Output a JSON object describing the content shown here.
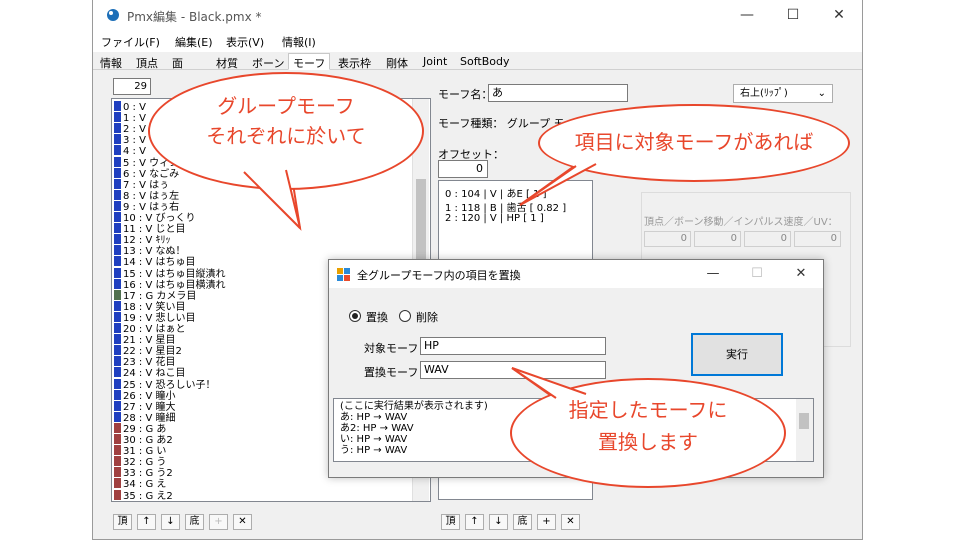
{
  "window": {
    "title": "Pmx編集 - Black.pmx *",
    "minimize": "—",
    "maximize": "☐",
    "close": "✕"
  },
  "menu": [
    "ファイル(F)",
    "編集(E)",
    "表示(V)",
    "情報(I)"
  ],
  "tabs": [
    "情報",
    "頂点",
    "面",
    "材質",
    "ボーン",
    "モーフ",
    "表示枠",
    "剛体",
    "Joint",
    "SoftBody"
  ],
  "left": {
    "count": "29",
    "rows": [
      {
        "text": "0 : V",
        "color": "#2040c0"
      },
      {
        "text": "1 : V",
        "color": "#2040c0"
      },
      {
        "text": "2 : V",
        "color": "#2040c0"
      },
      {
        "text": "3 : V",
        "color": "#2040c0"
      },
      {
        "text": "4 : V",
        "color": "#2040c0"
      },
      {
        "text": "5 : V  ウィンク",
        "color": "#2040c0"
      },
      {
        "text": "6 : V  なごみ",
        "color": "#2040c0"
      },
      {
        "text": "7 : V  はぅ",
        "color": "#2040c0"
      },
      {
        "text": "8 : V  はぅ左",
        "color": "#2040c0"
      },
      {
        "text": "9 : V  はぅ右",
        "color": "#2040c0"
      },
      {
        "text": "10 : V  びっくり",
        "color": "#2040c0"
      },
      {
        "text": "11 : V  じと目",
        "color": "#2040c0"
      },
      {
        "text": "12 : V  ｷﾘｯ",
        "color": "#2040c0"
      },
      {
        "text": "13 : V  なぬ！",
        "color": "#2040c0"
      },
      {
        "text": "14 : V  はちゅ目",
        "color": "#2040c0"
      },
      {
        "text": "15 : V  はちゅ目縦潰れ",
        "color": "#2040c0"
      },
      {
        "text": "16 : V  はちゅ目横潰れ",
        "color": "#2040c0"
      },
      {
        "text": "17 : G  カメラ目",
        "color": "#507050"
      },
      {
        "text": "18 : V  笑い目",
        "color": "#2040c0"
      },
      {
        "text": "19 : V  悲しい目",
        "color": "#2040c0"
      },
      {
        "text": "20 : V  はぁと",
        "color": "#2040c0"
      },
      {
        "text": "21 : V  星目",
        "color": "#2040c0"
      },
      {
        "text": "22 : V  星目2",
        "color": "#2040c0"
      },
      {
        "text": "23 : V  花目",
        "color": "#2040c0"
      },
      {
        "text": "24 : V  ねこ目",
        "color": "#2040c0"
      },
      {
        "text": "25 : V  恐ろしい子！",
        "color": "#2040c0"
      },
      {
        "text": "26 : V  瞳小",
        "color": "#2040c0"
      },
      {
        "text": "27 : V  瞳大",
        "color": "#2040c0"
      },
      {
        "text": "28 : V  瞳細",
        "color": "#2040c0"
      },
      {
        "text": "29 : G  あ",
        "color": "#a04040"
      },
      {
        "text": "30 : G  あ2",
        "color": "#a04040"
      },
      {
        "text": "31 : G  い",
        "color": "#a04040"
      },
      {
        "text": "32 : G  う",
        "color": "#a04040"
      },
      {
        "text": "33 : G  う2",
        "color": "#a04040"
      },
      {
        "text": "34 : G  え",
        "color": "#a04040"
      },
      {
        "text": "35 : G  え2",
        "color": "#a04040"
      }
    ],
    "buttons": [
      "頂",
      "↑",
      "↓",
      "底",
      "+",
      "✕"
    ]
  },
  "right": {
    "morph_name_label": "モーフ名：",
    "morph_name_value": "あ",
    "morph_type_label": "モーフ種類：  グループ モーフ",
    "offset_label": "オフセット：",
    "offset_value": "0",
    "panel_dropdown": "右上(ﾘｯﾌﾟ)",
    "items": [
      "0 : 104 | V | あE [ 1 ]",
      "1 : 118 | B | 歯舌 [ 0.82 ]",
      "2 : 120 | V | HP [ 1 ]"
    ],
    "buttons": [
      "頂",
      "↑",
      "↓",
      "底",
      "+",
      "✕"
    ],
    "group_label": "頂点／ボーン移動／インパルス速度／UV：",
    "values": [
      "0",
      "0",
      "0",
      "0"
    ]
  },
  "dialog": {
    "title": "全グループモーフ内の項目を置換",
    "radio_replace": "置換",
    "radio_delete": "削除",
    "target_label": "対象モーフ",
    "target_value": "HP",
    "replace_label": "置換モーフ",
    "replace_value": "WAV",
    "execute": "実行",
    "results": [
      "(ここに実行結果が表示されます)",
      "あ: HP → WAV",
      "あ2: HP → WAV",
      "い: HP → WAV",
      "う: HP → WAV"
    ]
  },
  "callouts": {
    "left_line1": "グループモーフ",
    "left_line2": "それぞれに於いて",
    "right": "項目に対象モーフがあれば",
    "bottom_line1": "指定したモーフに",
    "bottom_line2": "置換します",
    "color": "#e8472c"
  }
}
